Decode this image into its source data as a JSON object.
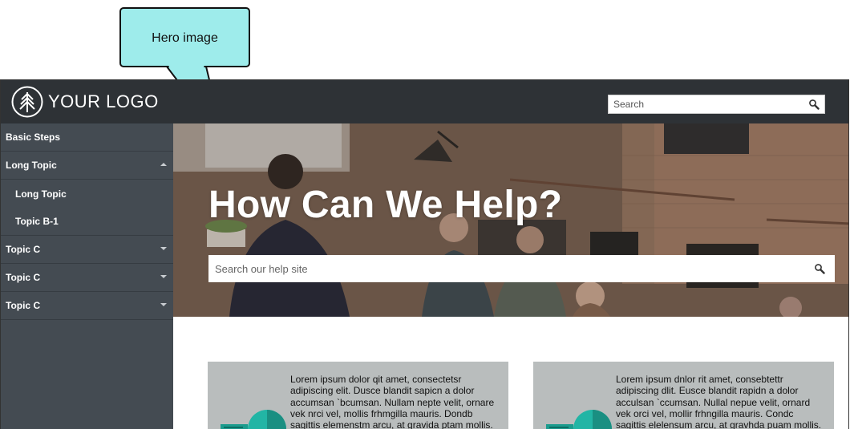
{
  "callout": {
    "text": "Hero image"
  },
  "header": {
    "logo_text": "YOUR LOGO",
    "search_placeholder": "Search"
  },
  "sidebar": {
    "items": [
      {
        "label": "Basic Steps",
        "level": 0,
        "arrow": ""
      },
      {
        "label": "Long Topic",
        "level": 0,
        "arrow": "up"
      },
      {
        "label": "Long Topic",
        "level": 1,
        "arrow": ""
      },
      {
        "label": "Topic B-1",
        "level": 1,
        "arrow": ""
      },
      {
        "label": "Topic C",
        "level": 0,
        "arrow": "down"
      },
      {
        "label": "Topic C",
        "level": 0,
        "arrow": "down"
      },
      {
        "label": "Topic C",
        "level": 0,
        "arrow": "down"
      }
    ]
  },
  "hero": {
    "title": "How Can We Help?",
    "search_placeholder": "Search our help site"
  },
  "cards": [
    {
      "text": "Lorem ipsum dolor qit amet, consectetsr adipiscing elit. Dusce blandit sapicn a dolor accumsan `bcumsan. Nullam nepte velit, ornare vek nrci vel, mollis frhmgilla mauris. Dondb sagittis elemenstm arcu, at gravida ptam mollis."
    },
    {
      "text": "Lorem ipsum dnlor rit amet, consebtettr adipiscing dlit. Eusce blandit rapidn a dolor acculsan `ccumsan. Nullal nepue velit, ornard vek orci vel, mollir frhngilla mauris. Condc sagittis elelensum arcu, at gravhda puam mollis."
    }
  ],
  "colors": {
    "header_bg": "#2e3236",
    "sidebar_bg": "#444b52",
    "callout_bg": "#9eeceb",
    "card_bg": "#b9bdbd",
    "accent_teal": "#1fb5a5"
  },
  "icons": {
    "logo": "tree-circle-icon",
    "search": "magnifier-icon",
    "expand": "chevron-up-icon",
    "collapse": "chevron-down-icon"
  }
}
